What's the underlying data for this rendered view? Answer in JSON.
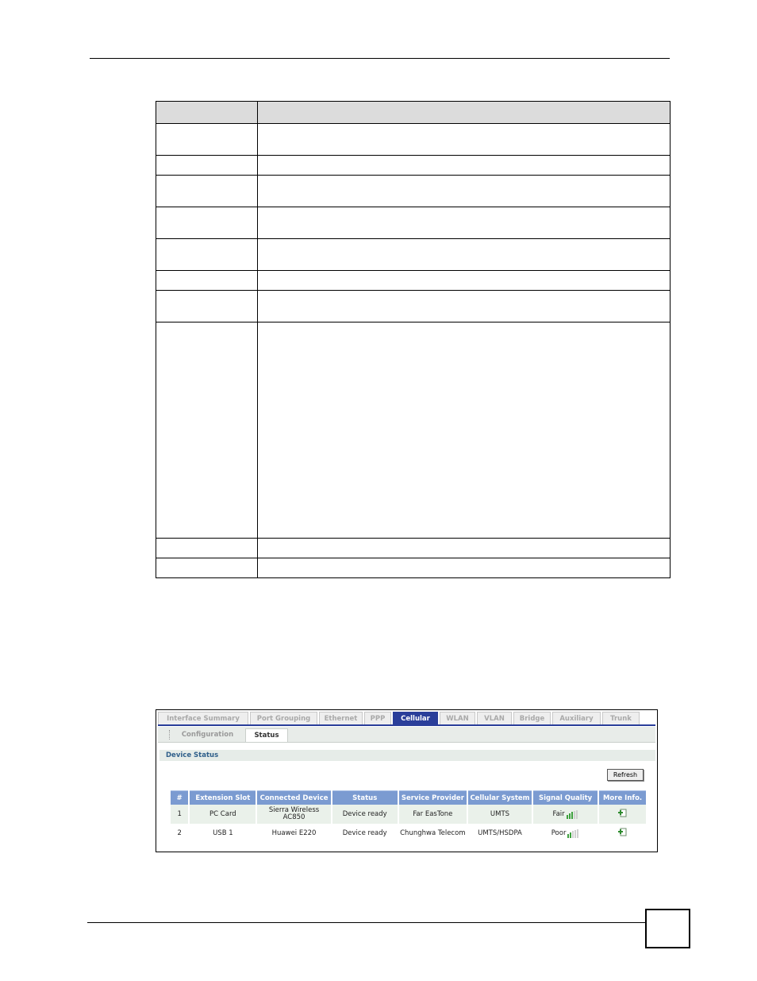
{
  "screenshot": {
    "tabs": [
      {
        "label": "Interface Summary",
        "active": false
      },
      {
        "label": "Port Grouping",
        "active": false
      },
      {
        "label": "Ethernet",
        "active": false
      },
      {
        "label": "PPP",
        "active": false
      },
      {
        "label": "Cellular",
        "active": true
      },
      {
        "label": "WLAN",
        "active": false
      },
      {
        "label": "VLAN",
        "active": false
      },
      {
        "label": "Bridge",
        "active": false
      },
      {
        "label": "Auxiliary",
        "active": false
      },
      {
        "label": "Trunk",
        "active": false
      }
    ],
    "subtabs": [
      {
        "label": "Configuration",
        "active": false
      },
      {
        "label": "Status",
        "active": true
      }
    ],
    "section_title": "Device Status",
    "refresh_label": "Refresh",
    "table": {
      "headers": [
        "#",
        "Extension Slot",
        "Connected Device",
        "Status",
        "Service Provider",
        "Cellular System",
        "Signal Quality",
        "More Info."
      ],
      "rows": [
        {
          "num": "1",
          "slot": "PC Card",
          "device": "Sierra Wireless AC850",
          "status": "Device ready",
          "provider": "Far EasTone",
          "system": "UMTS",
          "signal": "Fair",
          "signal_bars": 3
        },
        {
          "num": "2",
          "slot": "USB 1",
          "device": "Huawei E220",
          "status": "Device ready",
          "provider": "Chunghwa Telecom",
          "system": "UMTS/HSDPA",
          "signal": "Poor",
          "signal_bars": 2
        }
      ]
    },
    "colors": {
      "active_tab": "#2a3e9a",
      "table_header": "#7b9bd1",
      "section_title": "#2f5f8a",
      "signal_on": "#3ea03e"
    }
  }
}
